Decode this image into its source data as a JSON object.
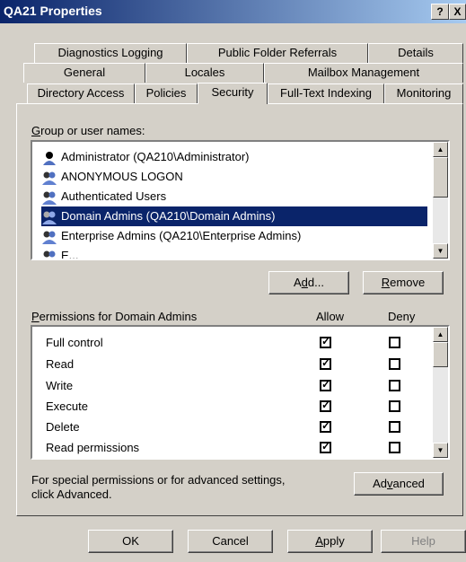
{
  "window": {
    "title": "QA21 Properties",
    "help_glyph": "?",
    "close_glyph": "X"
  },
  "tabs": {
    "row1": [
      "Diagnostics Logging",
      "Public Folder Referrals",
      "Details"
    ],
    "row2": [
      "General",
      "Locales",
      "Mailbox Management"
    ],
    "row3": [
      "Directory Access",
      "Policies",
      "Security",
      "Full-Text Indexing",
      "Monitoring"
    ],
    "active": "Security"
  },
  "group": {
    "label": "Group or user names:",
    "users": [
      "Administrator (QA210\\Administrator)",
      "ANONYMOUS LOGON",
      "Authenticated Users",
      "Domain Admins (QA210\\Domain Admins)",
      "Enterprise Admins (QA210\\Enterprise Admins)",
      "E..."
    ],
    "selected_index": 3,
    "add_label": "Add...",
    "remove_label": "Remove"
  },
  "permissions": {
    "label": "Permissions for Domain Admins",
    "allow_header": "Allow",
    "deny_header": "Deny",
    "rows": [
      {
        "name": "Full control",
        "allow": true,
        "deny": false
      },
      {
        "name": "Read",
        "allow": true,
        "deny": false
      },
      {
        "name": "Write",
        "allow": true,
        "deny": false
      },
      {
        "name": "Execute",
        "allow": true,
        "deny": false
      },
      {
        "name": "Delete",
        "allow": true,
        "deny": false
      },
      {
        "name": "Read permissions",
        "allow": true,
        "deny": false
      }
    ]
  },
  "advanced": {
    "text_line1": "For special permissions or for advanced settings,",
    "text_line2": "click Advanced.",
    "button_label": "Advanced"
  },
  "footer": {
    "ok": "OK",
    "cancel": "Cancel",
    "apply": "Apply",
    "help": "Help"
  },
  "colors": {
    "title_start": "#0a246a",
    "title_end": "#a6caf0",
    "selection": "#0a246a",
    "face": "#d4d0c8"
  }
}
